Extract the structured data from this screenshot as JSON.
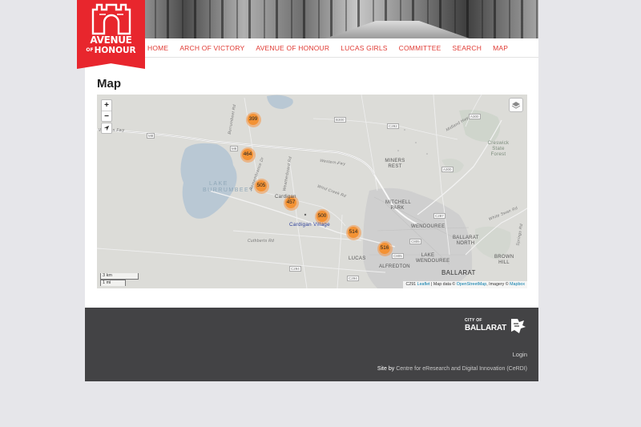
{
  "logo": {
    "line1": "AVENUE",
    "line2_small": "OF",
    "line2": "HONOUR"
  },
  "nav": {
    "items": [
      "HOME",
      "ARCH OF VICTORY",
      "AVENUE OF HONOUR",
      "LUCAS GIRLS",
      "COMMITTEE",
      "SEARCH",
      "MAP"
    ]
  },
  "page": {
    "title": "Map"
  },
  "map": {
    "zoom_in": "+",
    "zoom_out": "−",
    "clusters": [
      "399",
      "464",
      "505",
      "457",
      "500",
      "514",
      "516"
    ],
    "labels": {
      "lake": "LAKE",
      "burrumbeet": "BURRUMBEET",
      "miners_rest": "MINERS REST",
      "mitchell_park": "MITCHELL PARK",
      "wendouree": "WENDOUREE",
      "ballarat_north": "BALLARAT NORTH",
      "lake_wendouree": "LAKE WENDOUREE",
      "brown_hill": "BROWN HILL",
      "ballarat": "BALLARAT",
      "alfredton": "ALFREDTON",
      "lucas": "LUCAS",
      "cardigan_village": "Cardigan Village",
      "cardigan": "Cardigan",
      "creswick_forest": "Creswick State Forest",
      "western_fwy": "Western Fwy",
      "burrumbeet_rd": "Burrumbeet Rd",
      "remembrance_dr": "Remembrance Dr",
      "weatherboard_rd": "Weatherboard Rd",
      "cuthberts_rd": "Cuthberts Rd",
      "wind_creek_rd": "Wind Creek Rd",
      "midland_hwy": "Midland Hwy",
      "white_swan_rd": "White Swan Rd",
      "springs_rd": "Springs Rd"
    },
    "shields": [
      "M8",
      "C292",
      "B300",
      "A300",
      "M8",
      "C287",
      "A300",
      "C805",
      "C805",
      "C294",
      "C294",
      "C291"
    ],
    "scale": {
      "km": "3 km",
      "mi": "1 mi"
    },
    "attribution": {
      "leaflet": "Leaflet",
      "sep1": " | Map data © ",
      "osm": "OpenStreetMap",
      "sep2": ", Imagery © ",
      "mapbox": "Mapbox",
      "prefix": "C291"
    }
  },
  "footer": {
    "city_small": "CITY OF",
    "city_name": "BALLARAT",
    "login": "Login",
    "credit_prefix": "Site by",
    "credit_link": "Centre for eResearch and Digital Innovation (CeRDI)"
  }
}
